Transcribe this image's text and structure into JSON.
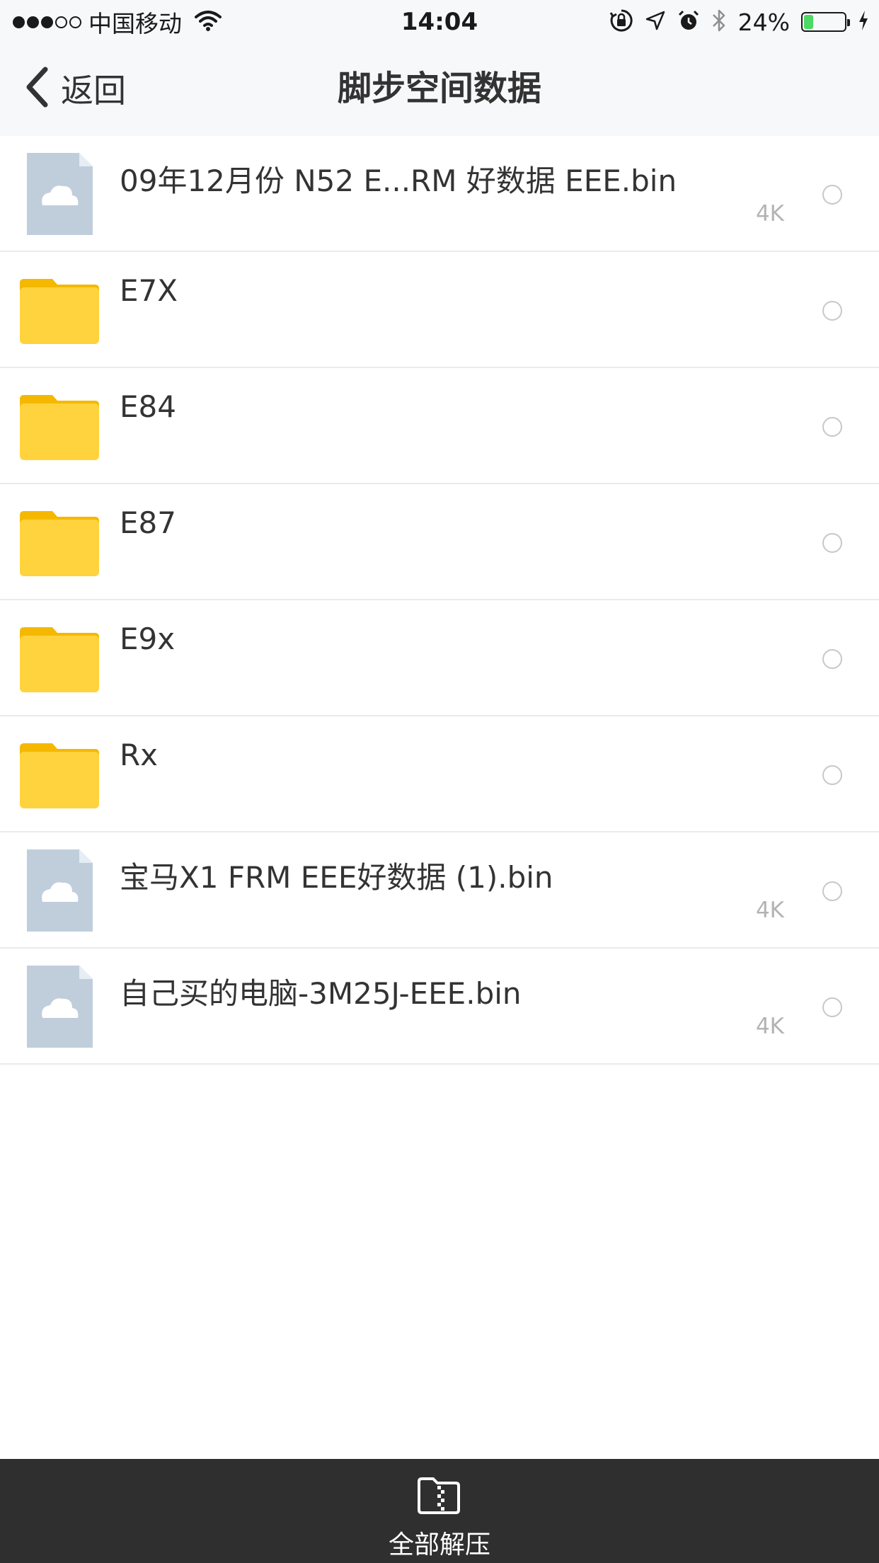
{
  "status_bar": {
    "carrier": "中国移动",
    "time": "14:04",
    "battery_percent": "24%",
    "battery_level": 0.24,
    "signal_bars_filled": 3,
    "signal_bars_total": 5
  },
  "nav": {
    "back_label": "返回",
    "title": "脚步空间数据"
  },
  "files": [
    {
      "type": "file",
      "name": "09年12月份 N52 E...RM 好数据 EEE.bin",
      "size": "4K"
    },
    {
      "type": "folder",
      "name": "E7X",
      "size": ""
    },
    {
      "type": "folder",
      "name": "E84",
      "size": ""
    },
    {
      "type": "folder",
      "name": "E87",
      "size": ""
    },
    {
      "type": "folder",
      "name": "E9x",
      "size": ""
    },
    {
      "type": "folder",
      "name": "Rx",
      "size": ""
    },
    {
      "type": "file",
      "name": "宝马X1 FRM EEE好数据 (1).bin",
      "size": "4K"
    },
    {
      "type": "file",
      "name": "自己买的电脑-3M25J-EEE.bin",
      "size": "4K"
    }
  ],
  "toolbar": {
    "extract_all_label": "全部解压"
  },
  "colors": {
    "folder": "#ffd33d",
    "folder_tab": "#f5b800",
    "file_icon": "#c0cedc",
    "toolbar_bg": "#2f2f2f",
    "battery_fill": "#4cd964"
  },
  "icons": {
    "file": "cloud-file-icon",
    "folder": "folder-icon",
    "extract": "zip-folder-icon",
    "back": "chevron-left-icon"
  }
}
